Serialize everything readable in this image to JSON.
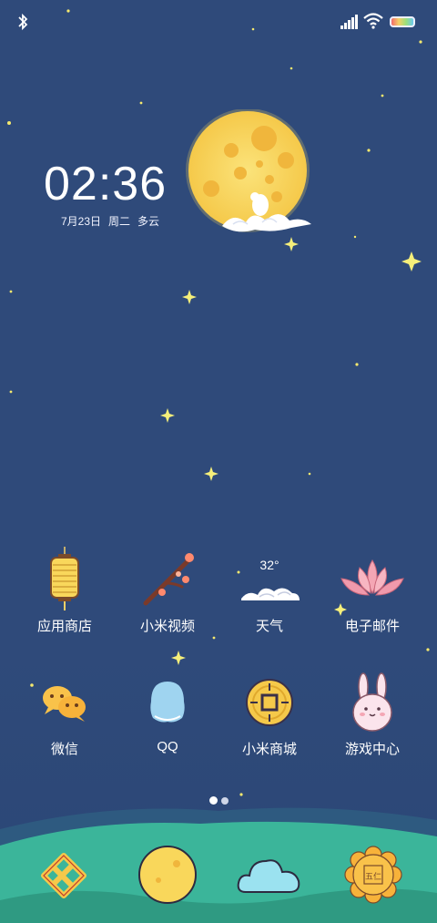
{
  "status": {
    "bluetooth_icon": "bluetooth-icon",
    "signal_icon": "signal-icon",
    "wifi_icon": "wifi-icon",
    "battery_icon": "battery-icon"
  },
  "clock": {
    "time": "02:36",
    "date": "7月23日",
    "weekday": "周二",
    "weather": "多云"
  },
  "apps_row1": [
    {
      "label": "应用商店",
      "icon": "lantern-icon"
    },
    {
      "label": "小米视频",
      "icon": "plum-branch-icon"
    },
    {
      "label": "天气",
      "icon": "cloud-weather-icon",
      "temp": "32°"
    },
    {
      "label": "电子邮件",
      "icon": "lotus-icon"
    }
  ],
  "apps_row2": [
    {
      "label": "微信",
      "icon": "chat-bubbles-icon"
    },
    {
      "label": "QQ",
      "icon": "penguin-icon"
    },
    {
      "label": "小米商城",
      "icon": "coin-icon"
    },
    {
      "label": "游戏中心",
      "icon": "rabbit-icon"
    }
  ],
  "pager": {
    "pages": 2,
    "active": 1
  },
  "dock": [
    {
      "icon": "chinese-knot-icon"
    },
    {
      "icon": "moon-icon"
    },
    {
      "icon": "cloud-icon"
    },
    {
      "icon": "mooncake-icon",
      "text": "五仁"
    }
  ],
  "colors": {
    "sky": "#2f4a7a",
    "moon": "#f9d75b",
    "grass": "#3bb59a"
  }
}
